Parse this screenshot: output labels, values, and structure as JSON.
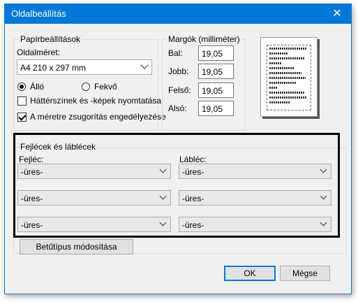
{
  "window": {
    "title": "Oldalbeállítás",
    "close_label": "✕"
  },
  "paper": {
    "legend": "Papírbeállítások",
    "size_label": "Oldalméret:",
    "size_value": "A4 210 x 297 mm",
    "orientation": {
      "portrait": "Álló",
      "landscape": "Fekvő",
      "selected": "portrait"
    },
    "print_bg_label": "Háttérszínek és -képek nyomtatása",
    "print_bg_checked": false,
    "shrink_label": "A méretre zsugorítás engedélyezése",
    "shrink_checked": true
  },
  "margins": {
    "legend": "Margók (milliméter)",
    "left_label": "Bal:",
    "left_value": "19,05",
    "right_label": "Jobb:",
    "right_value": "19,05",
    "top_label": "Felső:",
    "top_value": "19,05",
    "bottom_label": "Alsó:",
    "bottom_value": "19,05"
  },
  "headers": {
    "legend": "Fejlécek és láblécek",
    "header_label": "Fejléc:",
    "footer_label": "Lábléc:",
    "header_values": [
      "-üres-",
      "-üres-",
      "-üres-"
    ],
    "footer_values": [
      "-üres-",
      "-üres-",
      "-üres-"
    ],
    "font_button": "Betűtípus módosítása"
  },
  "buttons": {
    "ok": "OK",
    "cancel": "Mégse"
  },
  "colors": {
    "titlebar": "#0078d7",
    "highlight_border": "#000000"
  }
}
